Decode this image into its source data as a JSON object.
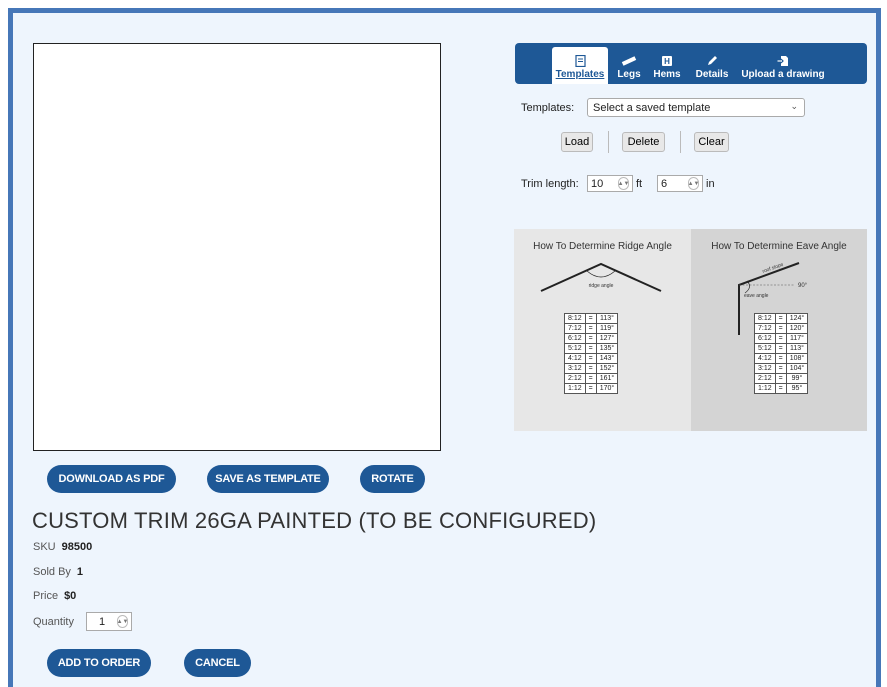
{
  "actions": {
    "download_pdf": "DOWNLOAD AS PDF",
    "save_template": "SAVE AS TEMPLATE",
    "rotate": "ROTATE",
    "add_to_order": "ADD TO ORDER",
    "cancel": "CANCEL"
  },
  "product": {
    "title": "CUSTOM TRIM 26GA PAINTED (TO BE CONFIGURED)",
    "sku_label": "SKU",
    "sku": "98500",
    "sold_by_label": "Sold By",
    "sold_by": "1",
    "price_label": "Price",
    "price": "$0",
    "quantity_label": "Quantity",
    "quantity": "1"
  },
  "tabs": [
    {
      "label": "Templates",
      "icon": "document-icon",
      "active": true
    },
    {
      "label": "Legs",
      "icon": "ruler-icon",
      "active": false
    },
    {
      "label": "Hems",
      "icon": "hem-icon",
      "active": false
    },
    {
      "label": "Details",
      "icon": "pencil-icon",
      "active": false
    },
    {
      "label": "Upload a drawing",
      "icon": "upload-icon",
      "active": false
    }
  ],
  "templates": {
    "label": "Templates:",
    "selected": "Select a saved template",
    "load": "Load",
    "delete": "Delete",
    "clear": "Clear"
  },
  "trim": {
    "label": "Trim length:",
    "feet": "10",
    "feet_unit": "ft",
    "inches": "6",
    "inches_unit": "in"
  },
  "guide": {
    "ridge_title": "How To Determine Ridge Angle",
    "ridge_caption": "ridge angle",
    "ridge_rows": [
      [
        "8:12",
        "=",
        "113°"
      ],
      [
        "7:12",
        "=",
        "119°"
      ],
      [
        "6:12",
        "=",
        "127°"
      ],
      [
        "5:12",
        "=",
        "135°"
      ],
      [
        "4:12",
        "=",
        "143°"
      ],
      [
        "3:12",
        "=",
        "152°"
      ],
      [
        "2:12",
        "=",
        "161°"
      ],
      [
        "1:12",
        "=",
        "170°"
      ]
    ],
    "eave_title": "How To Determine Eave Angle",
    "eave_roof_caption": "roof slope",
    "eave_angle_caption": "eave angle",
    "eave_right": "90°",
    "eave_rows": [
      [
        "8:12",
        "=",
        "124°"
      ],
      [
        "7:12",
        "=",
        "120°"
      ],
      [
        "6:12",
        "=",
        "117°"
      ],
      [
        "5:12",
        "=",
        "113°"
      ],
      [
        "4:12",
        "=",
        "108°"
      ],
      [
        "3:12",
        "=",
        "104°"
      ],
      [
        "2:12",
        "=",
        "99°"
      ],
      [
        "1:12",
        "=",
        "95°"
      ]
    ]
  },
  "colors": {
    "primary": "#1e5896",
    "frame": "#4677b8",
    "panel": "#eef5fd"
  }
}
